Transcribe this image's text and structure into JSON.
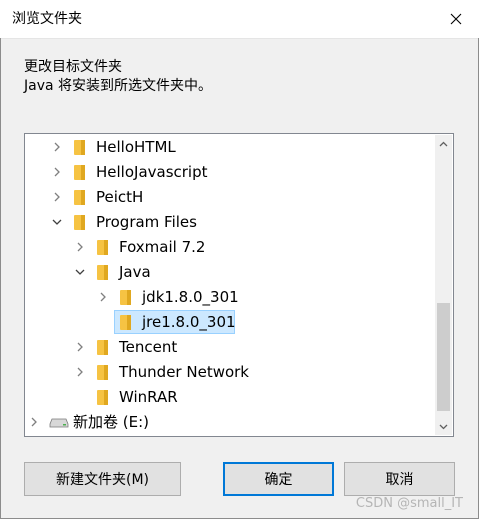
{
  "window": {
    "title": "浏览文件夹"
  },
  "instructions": {
    "line1": "更改目标文件夹",
    "line2": "Java 将安装到所选文件夹中。"
  },
  "tree": {
    "items": [
      {
        "label": "HelloHTML",
        "expanded": false,
        "icon": "folder-icon"
      },
      {
        "label": "HelloJavascript",
        "expanded": false,
        "icon": "folder-icon"
      },
      {
        "label": "PeictH",
        "expanded": false,
        "icon": "folder-icon"
      },
      {
        "label": "Program Files",
        "expanded": true,
        "icon": "folder-icon"
      },
      {
        "label": "Foxmail 7.2",
        "expanded": false,
        "icon": "folder-icon"
      },
      {
        "label": "Java",
        "expanded": true,
        "icon": "folder-icon"
      },
      {
        "label": "jdk1.8.0_301",
        "expanded": false,
        "icon": "folder-icon"
      },
      {
        "label": "jre1.8.0_301",
        "selected": true,
        "icon": "folder-icon"
      },
      {
        "label": "Tencent",
        "expanded": false,
        "icon": "folder-icon"
      },
      {
        "label": "Thunder Network",
        "expanded": false,
        "icon": "folder-icon"
      },
      {
        "label": "WinRAR",
        "icon": "folder-icon"
      },
      {
        "label": "新加卷 (E:)",
        "expanded": false,
        "icon": "drive-icon"
      }
    ]
  },
  "buttons": {
    "new_folder": "新建文件夹(M)",
    "ok": "确定",
    "cancel": "取消"
  },
  "watermark": "CSDN @small_IT",
  "colors": {
    "folder": "#f6c343",
    "selection": "#cce8ff",
    "selection_border": "#99d1ff",
    "accent": "#0078d7"
  }
}
